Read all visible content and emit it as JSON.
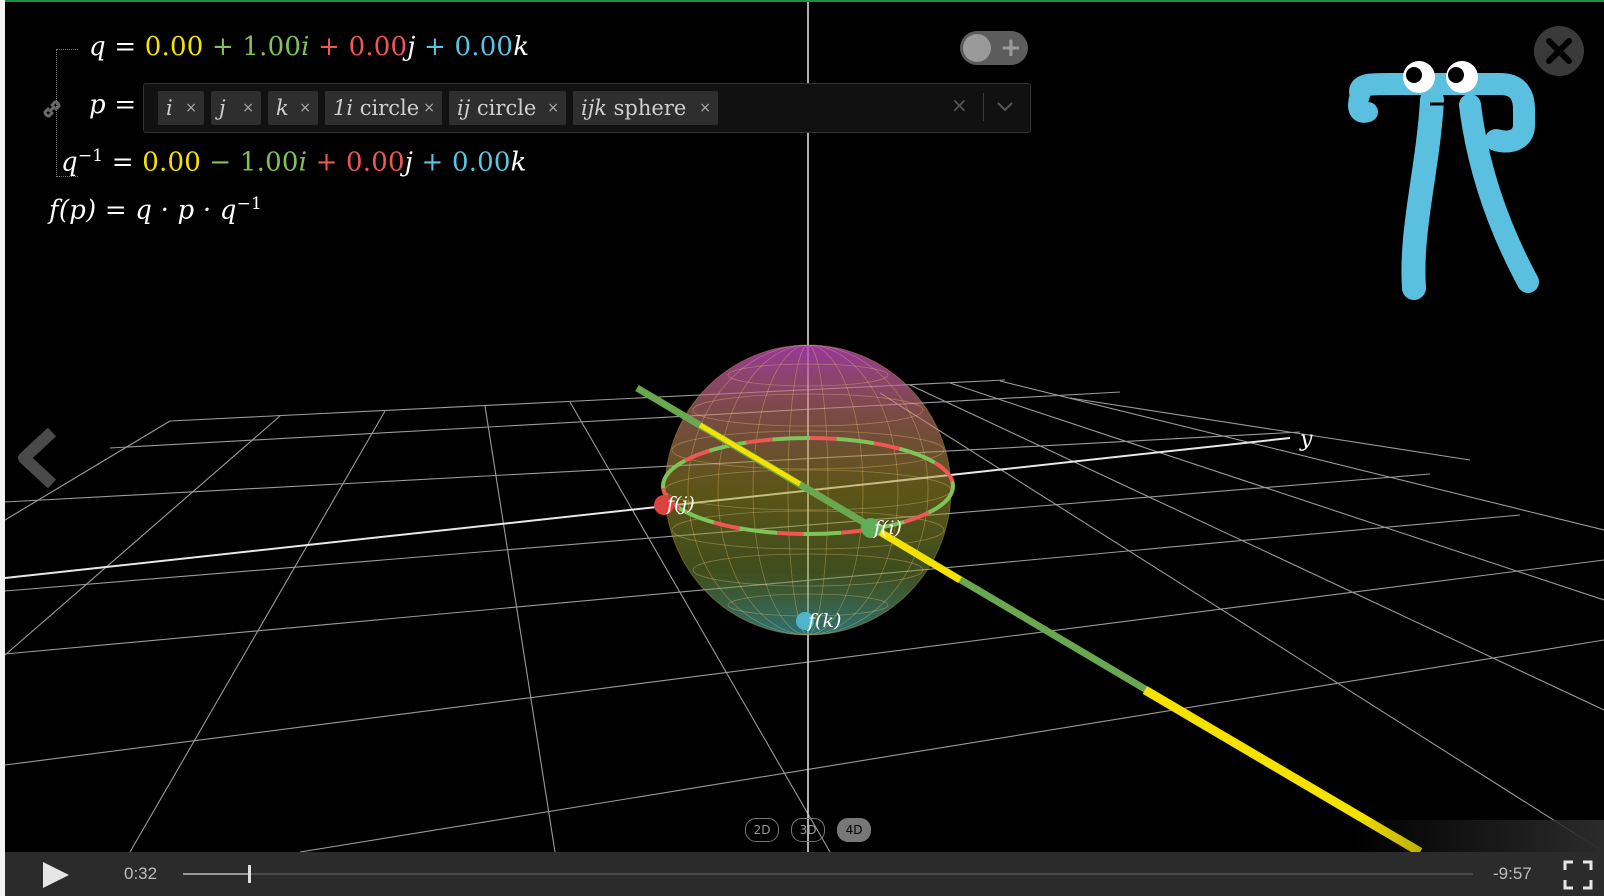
{
  "equations": {
    "q": {
      "lhs": "q",
      "eq": "=",
      "a": "0.00",
      "op1": "+",
      "b": "1.00",
      "u1": "i",
      "op2": "+",
      "c": "0.00",
      "u2": "j",
      "op3": "+",
      "d": "0.00",
      "u3": "k"
    },
    "p": {
      "lhs": "p",
      "eq": "="
    },
    "qinv": {
      "lhs": "q",
      "sup": "−1",
      "eq": "=",
      "a": "0.00",
      "op1": "−",
      "b": "1.00",
      "u1": "i",
      "op2": "+",
      "c": "0.00",
      "u2": "j",
      "op3": "+",
      "d": "0.00",
      "u3": "k"
    },
    "f": {
      "text": "f(p) = q · p · q",
      "sup": "−1"
    }
  },
  "p_input": {
    "chips": [
      {
        "math": "i",
        "label": "",
        "remove": "×"
      },
      {
        "math": "j",
        "label": "",
        "remove": "×"
      },
      {
        "math": "k",
        "label": "",
        "remove": "×"
      },
      {
        "math": "1i",
        "label": "circle",
        "remove": "×"
      },
      {
        "math": "ij",
        "label": "circle",
        "remove": "×"
      },
      {
        "math": "ijk",
        "label": "sphere",
        "remove": "×"
      }
    ],
    "clear": "×"
  },
  "scene": {
    "axis_label_y": "y",
    "point_labels": {
      "fj": "f(j)",
      "fi": "f(i)",
      "fk": "f(k)"
    }
  },
  "dimension_buttons": {
    "d2": "2D",
    "d3": "3D",
    "d4": "4D",
    "active": "4D"
  },
  "player": {
    "elapsed": "0:32",
    "remaining": "-9:57",
    "progress_fraction": 0.051
  },
  "colors": {
    "scalar": "#f5e200",
    "i": "#7fc35a",
    "j": "#ef5656",
    "k": "#5bc4e3",
    "pi_creature": "#5bc0df"
  },
  "icons": [
    "link-icon",
    "toggle-add-icon",
    "close-icon",
    "chevron-down-icon",
    "back-chevron-icon",
    "play-icon",
    "fullscreen-icon",
    "pi-creature-logo"
  ]
}
